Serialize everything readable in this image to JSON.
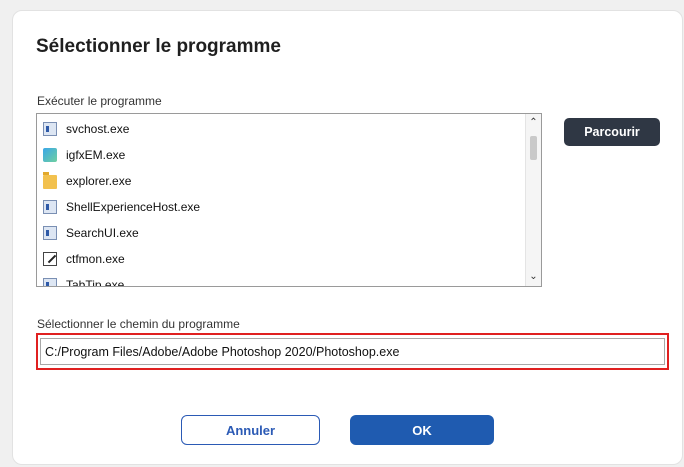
{
  "dialog": {
    "title": "Sélectionner le programme",
    "run_label": "Exécuter le programme",
    "browse_label": "Parcourir",
    "path_label": "Sélectionner le chemin du programme",
    "path_value": "C:/Program Files/Adobe/Adobe Photoshop 2020/Photoshop.exe",
    "cancel_label": "Annuler",
    "ok_label": "OK"
  },
  "programs": [
    {
      "name": "svchost.exe",
      "icon": "window-icon"
    },
    {
      "name": "igfxEM.exe",
      "icon": "app-icon"
    },
    {
      "name": "explorer.exe",
      "icon": "folder-icon"
    },
    {
      "name": "ShellExperienceHost.exe",
      "icon": "window-icon"
    },
    {
      "name": "SearchUI.exe",
      "icon": "window-icon"
    },
    {
      "name": "ctfmon.exe",
      "icon": "pen-icon"
    },
    {
      "name": "TabTip.exe",
      "icon": "window-icon"
    }
  ],
  "colors": {
    "accent": "#1f5bb0",
    "highlight_border": "#e02020",
    "browse_button_bg": "#2f3744"
  }
}
